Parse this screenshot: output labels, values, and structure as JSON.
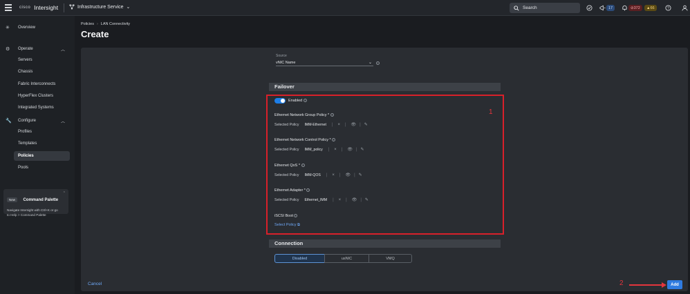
{
  "header": {
    "brand_logo": "cisco",
    "brand_name": "Intersight",
    "service": "Infrastructure Service",
    "search_placeholder": "Search",
    "notifications": {
      "announcements": "17",
      "critical": "372",
      "warning": "66"
    }
  },
  "sidebar": {
    "items": [
      {
        "label": "Overview",
        "icon": "overview-icon"
      },
      {
        "label": "Operate",
        "icon": "operate-icon"
      },
      {
        "label": "Servers"
      },
      {
        "label": "Chassis"
      },
      {
        "label": "Fabric Interconnects"
      },
      {
        "label": "HyperFlex Clusters"
      },
      {
        "label": "Integrated Systems"
      },
      {
        "label": "Configure",
        "icon": "configure-icon"
      },
      {
        "label": "Profiles"
      },
      {
        "label": "Templates"
      },
      {
        "label": "Policies"
      },
      {
        "label": "Pools"
      }
    ],
    "palette": {
      "badge": "New",
      "title": "Command Palette",
      "desc_line1": "Navigate Intersight with Ctrl+K or go",
      "desc_line2": "to Help > Command Palette"
    }
  },
  "breadcrumb": {
    "first": "Policies",
    "second": "LAN Connectivity"
  },
  "page_title": "Create",
  "form": {
    "source_label": "Source",
    "source_value": "vNIC Name",
    "failover_title": "Failover",
    "enabled_label": "Enabled",
    "policies": [
      {
        "title": "Ethernet Network Group Policy *",
        "row_label": "Selected Policy",
        "value": "IMM-Ethernet"
      },
      {
        "title": "Ethernet Network Control Policy *",
        "row_label": "Selected Policy",
        "value": "IMM_policy"
      },
      {
        "title": "Ethernet QoS *",
        "row_label": "Selected Policy",
        "value": "IMM-QOS"
      },
      {
        "title": "Ethernet Adapter *",
        "row_label": "Selected Policy",
        "value": "Ethernet_IMM"
      }
    ],
    "iscsi_title": "iSCSI Boot",
    "select_policy": "Select Policy",
    "connection_title": "Connection",
    "connection_options": [
      "Disabled",
      "usNIC",
      "VMQ"
    ],
    "connection_selected": "Disabled"
  },
  "annotations": {
    "box_number": "1",
    "arrow_number": "2"
  },
  "footer": {
    "cancel": "Cancel",
    "add": "Add"
  },
  "colors": {
    "accent": "#2f7be0",
    "highlight": "#d9202a",
    "link": "#6fa8f5"
  }
}
